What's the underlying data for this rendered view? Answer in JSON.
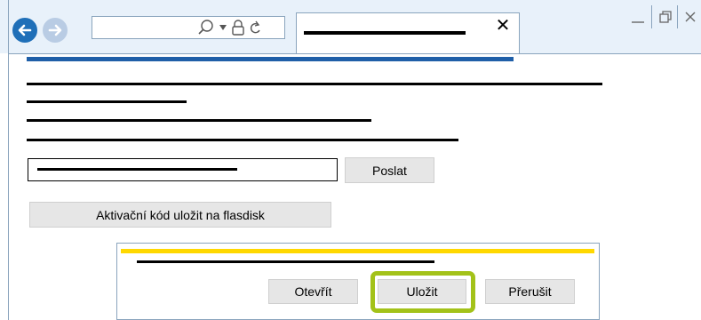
{
  "browser": {
    "icons": {
      "back": "arrow-left-icon",
      "forward": "arrow-right-icon",
      "search": "search-icon",
      "dropdown": "chevron-down-icon",
      "lock": "lock-icon",
      "refresh": "refresh-icon",
      "tab_close": "close-icon",
      "minimize": "minimize-icon",
      "restore": "restore-icon",
      "window_close": "close-icon"
    },
    "tab_close_glyph": "✕"
  },
  "page": {
    "send_button_label": "Poslat",
    "save_activation_code_label": "Aktivační kód uložit na flasdisk"
  },
  "dialog": {
    "open_label": "Otevřít",
    "save_label": "Uložit",
    "cancel_label": "Přerušit"
  },
  "colors": {
    "accent_blue": "#1f5fa8",
    "dialog_accent_yellow": "#ffd800",
    "highlight_green": "#a3c219",
    "chrome_background": "#e8f1fa",
    "button_gray": "#e6e6e6"
  }
}
